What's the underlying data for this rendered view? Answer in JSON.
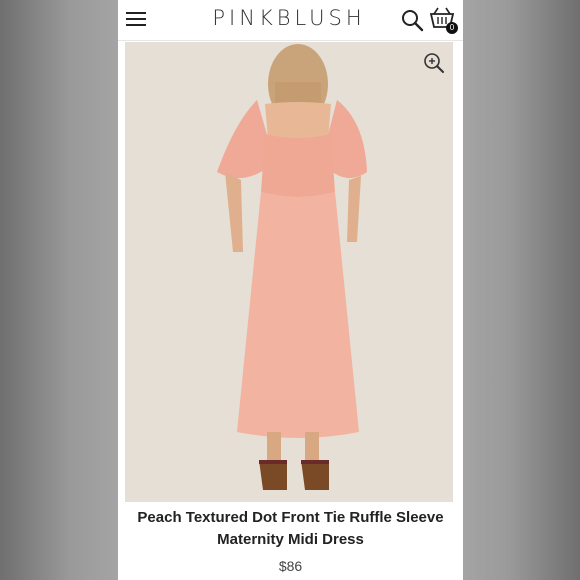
{
  "header": {
    "logo": "PINKBLUSH",
    "cart_count": "0",
    "icons": {
      "menu": "hamburger-menu-icon",
      "search": "search-icon",
      "cart": "shopping-cart-icon"
    }
  },
  "product": {
    "image_alt": "peach-dress-back-view",
    "zoom_icon": "zoom-in-icon",
    "title_line1": "Peach Textured Dot Front Tie Ruffle Sleeve",
    "title_line2": "Maternity Midi Dress",
    "price": "$86"
  },
  "colors": {
    "dress": "#f2b3a0",
    "backdrop": "#e6dfd5",
    "text": "#222222"
  }
}
